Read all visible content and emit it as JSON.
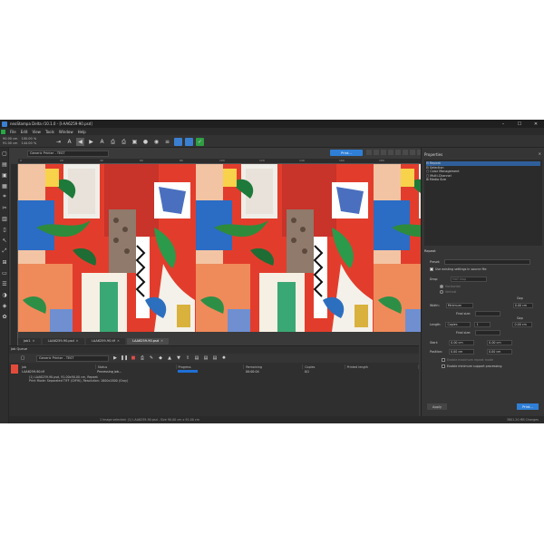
{
  "window": {
    "title": "neoStampa Delta r10.1.0 - [I-AA6259-90.psd]",
    "controls": [
      "–",
      "☐",
      "✕"
    ]
  },
  "menu": [
    "File",
    "Edit",
    "View",
    "Tools",
    "Window",
    "Help"
  ],
  "toolbar": {
    "info": [
      [
        "90.00 cm",
        "100.00 %"
      ],
      [
        "91.00 cm",
        "144.00 %"
      ]
    ]
  },
  "canvas": {
    "printer": "Generic Printer - TEST",
    "print_button": "Print...",
    "ruler_ticks": [
      "0",
      "20",
      "40",
      "60",
      "80",
      "100",
      "120",
      "140",
      "160",
      "180"
    ]
  },
  "doc_tabs": [
    {
      "label": "Job1",
      "active": false
    },
    {
      "label": "I-AA6259-90.psd",
      "active": false
    },
    {
      "label": "I-AA6259-90.tif",
      "active": false
    },
    {
      "label": "I-AA6259-90.psd",
      "active": true
    }
  ],
  "job_queue": {
    "title": "Job Queue",
    "printer": "Generic Printer - TEST",
    "columns": [
      "Job",
      "Status",
      "Progress",
      "Remaining",
      "Copies",
      "Printed length"
    ],
    "row": {
      "job": "I-AA6259-90.tif",
      "status": "Processing job...",
      "progress": "",
      "remaining": "00:00:04",
      "copies": "0/1",
      "printed_length": ""
    },
    "detail_lines": [
      "(1) I-AA6259-90.psd, 91.00x90.00 cm, Repeat",
      "Print Mode: Separated TIFF (CMYK), Resolution: 1800x1800 (Gray)"
    ],
    "tabs": [
      "All",
      "Pending",
      "Active",
      "Finished"
    ]
  },
  "status": {
    "message": "1 Image selected: (1) I-AA6259-90.psd - Size 90.00 cm x 91.00 cm",
    "right": "3801.20 MB  Changes"
  },
  "properties": {
    "title": "Properties",
    "tree": [
      {
        "label": "⊟ Repeat",
        "selected": true
      },
      {
        "label": "   ⊟ Selection",
        "selected": false
      },
      {
        "label": "      ▢ Color Management",
        "selected": false
      },
      {
        "label": "      ▢ Multi-Channel",
        "selected": false
      },
      {
        "label": "⊞ Media Size",
        "selected": false
      }
    ],
    "repeat": {
      "header": "Repeat",
      "preset_label": "Preset:",
      "preset_value": "",
      "use_existing": "Use existing settings in source file",
      "drop_label": "Drop:",
      "drop_value": "Half drop",
      "horizontal": "Horizontal",
      "vertical": "Vertical",
      "gap_label": "Gap",
      "gap_value": "0.00 cm",
      "width_label": "Width:",
      "width_value": "Minimum",
      "final_size_label": "Final size:",
      "final_size_value": "",
      "length_label": "Length:",
      "length_value": "Copies",
      "length_count": "1",
      "start_label": "Start:",
      "start_x": "0.00 cm",
      "start_y": "0.00 cm",
      "position_label": "Position:",
      "pos_x": "0.00 cm",
      "pos_y": "0.00 cm",
      "enable_max": "Enable maximum repeat mode",
      "enable_min": "Enable minimum support processing",
      "apply": "Apply",
      "print": "Print..."
    }
  }
}
